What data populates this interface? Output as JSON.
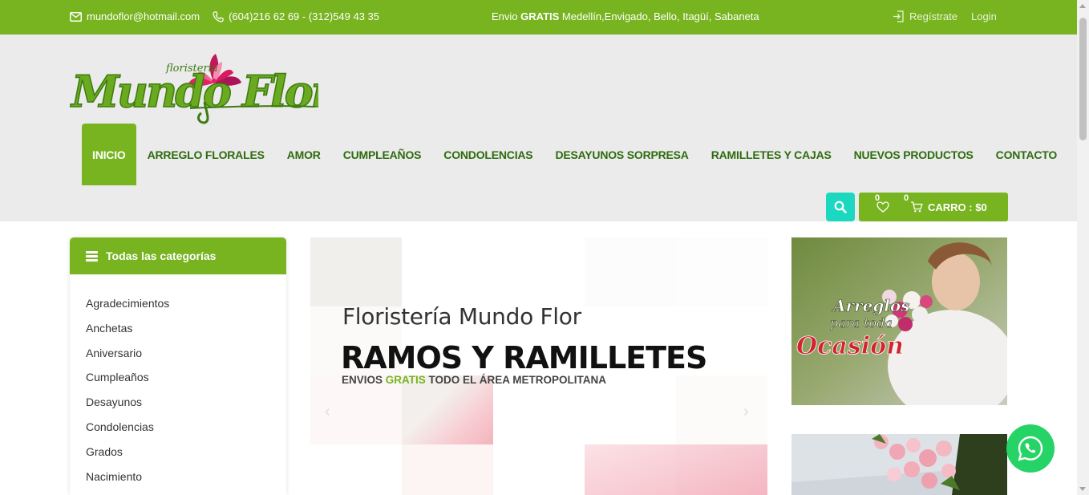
{
  "topbar": {
    "email": "mundoflor@hotmail.com",
    "phone": "(604)216 62 69 - (312)549 43 35",
    "shipping_prefix": "Envio ",
    "shipping_bold": "GRATIS",
    "shipping_suffix": " Medellín,Envigado, Bello, Itagüí, Sabaneta",
    "register": "Regístrate",
    "login": "Login",
    "bg_color": "#77b41f"
  },
  "logo": {
    "small_text": "floristeria",
    "main_text": "Mundo Flor"
  },
  "nav": {
    "items": [
      {
        "label": "INICIO"
      },
      {
        "label": "ARREGLO FLORALES"
      },
      {
        "label": "AMOR"
      },
      {
        "label": "CUMPLEAÑOS"
      },
      {
        "label": "CONDOLENCIAS"
      },
      {
        "label": "DESAYUNOS SORPRESA"
      },
      {
        "label": "RAMILLETES Y CAJAS"
      },
      {
        "label": "NUEVOS PRODUCTOS"
      },
      {
        "label": "CONTACTO"
      }
    ],
    "active_index": 0
  },
  "cart": {
    "wishlist_count": "0",
    "cart_count": "0",
    "label": "CARRO : $0"
  },
  "categories": {
    "title": "Todas las categorías",
    "items": [
      "Agradecimientos",
      "Anchetas",
      "Aniversario",
      "Cumpleaños",
      "Desayunos",
      "Condolencias",
      "Grados",
      "Nacimiento"
    ]
  },
  "hero": {
    "subtitle": "Floristería Mundo Flor",
    "title": "RAMOS Y RAMILLETES",
    "tag_prefix": "ENVIOS ",
    "tag_highlight": "GRATIS",
    "tag_suffix": " TODO EL ÁREA METROPOLITANA"
  },
  "side_ad": {
    "line1": "Arreglos",
    "line2": "para toda",
    "line3": "Ocasión"
  },
  "colors": {
    "primary_green": "#77b41f",
    "nav_text": "#2e6b0e",
    "search_teal": "#1dd8c1",
    "whatsapp": "#25d366"
  }
}
